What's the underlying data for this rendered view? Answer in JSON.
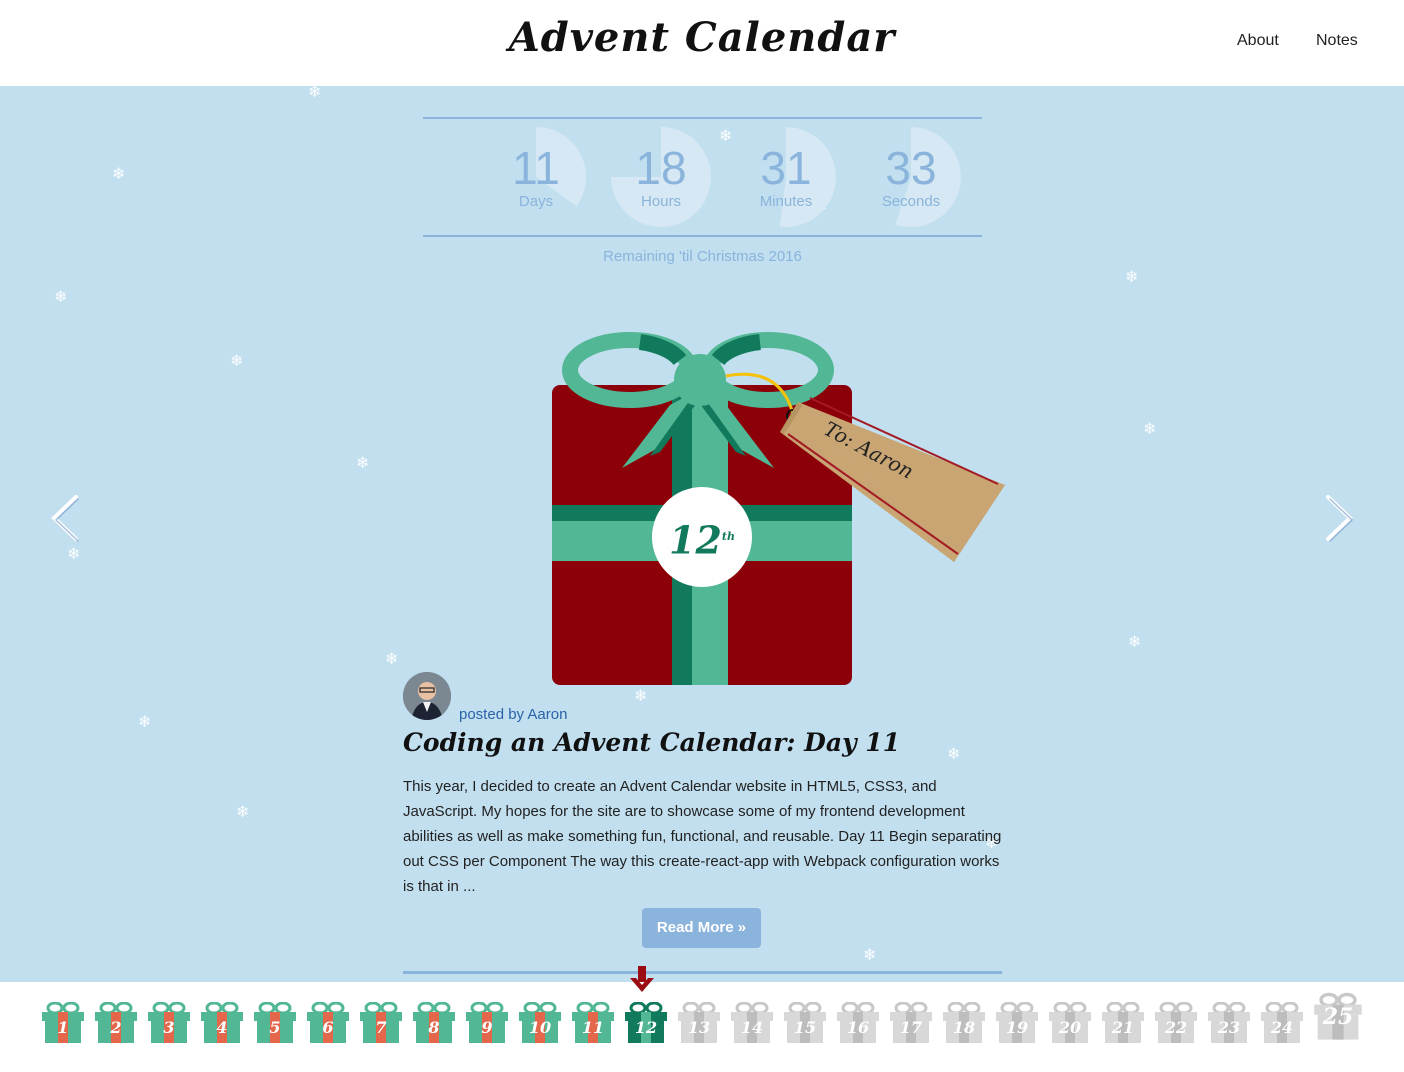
{
  "header": {
    "brand": "Advent Calendar",
    "nav": [
      "About",
      "Notes"
    ]
  },
  "countdown": {
    "units": [
      {
        "value": "11",
        "label": "Days",
        "fraction": 0.35
      },
      {
        "value": "18",
        "label": "Hours",
        "fraction": 0.75
      },
      {
        "value": "31",
        "label": "Minutes",
        "fraction": 0.52
      },
      {
        "value": "33",
        "label": "Seconds",
        "fraction": 0.55
      }
    ],
    "caption": "Remaining 'til Christmas 2016"
  },
  "feature": {
    "day_number": "12",
    "day_suffix": "th",
    "tag_text": "To: Aaron",
    "colors": {
      "box": "#8b0009",
      "ribbon": "#52b795",
      "ribbon_dark": "#127a5c",
      "tag": "#c9a574"
    }
  },
  "post": {
    "byline": "posted by Aaron",
    "title": "Coding an Advent Calendar: Day 11",
    "excerpt": "This year, I decided to create an Advent Calendar website in HTML5, CSS3, and JavaScript. My hopes for the site are to showcase some of my frontend development abilities as well as make something fun, functional, and reusable. Day 11 Begin separating out CSS per Component The way this create-react-app with Webpack configuration works is that in ...",
    "read_more": "Read More »"
  },
  "days": {
    "labels": [
      "1",
      "2",
      "3",
      "4",
      "5",
      "6",
      "7",
      "8",
      "9",
      "10",
      "11",
      "12",
      "13",
      "14",
      "15",
      "16",
      "17",
      "18",
      "19",
      "20",
      "21",
      "22",
      "23",
      "24",
      "25"
    ],
    "unlocked_through": 11,
    "current": 12
  },
  "icons": [
    "chevron-left-icon",
    "chevron-right-icon",
    "snowflake-icon",
    "down-arrow-icon",
    "gift-icon"
  ]
}
